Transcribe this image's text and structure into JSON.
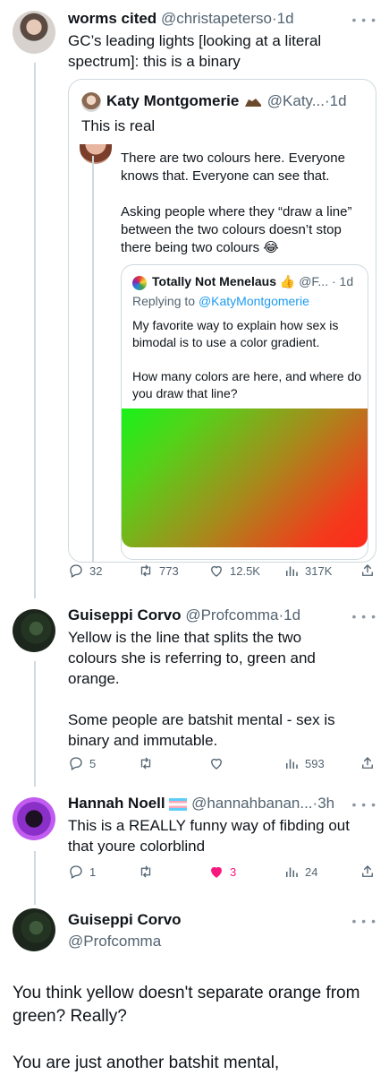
{
  "tweet1": {
    "name": "worms cited",
    "handle": "@christapeterso",
    "time": "1d",
    "text": "GC’s leading lights [looking at a literal spectrum]: this is a binary",
    "quote": {
      "name": "Katy Montgomerie",
      "handle": "@Katy...",
      "time": "1d",
      "text": "This is real",
      "inner_text": "There are two colours here. Everyone knows that. Everyone can see that.\n\nAsking people where they “draw a line” between the two colours doesn’t stop there being two colours 😂",
      "nested": {
        "name": "Totally Not Menelaus",
        "handle": "@F...",
        "time": "1d",
        "reply_prefix": "Replying to ",
        "reply_to": "@KatyMontgomerie",
        "text": "My favorite way to explain how sex is bimodal is to use a color gradient.\n\nHow many colors are here, and where do you draw that line?",
        "gradient_colors": [
          "#18f21a",
          "#f33a1c"
        ]
      }
    },
    "stats": {
      "replies": "32",
      "retweets": "773",
      "likes": "12.5K",
      "views": "317K"
    }
  },
  "tweet2": {
    "name": "Guiseppi Corvo",
    "handle": "@Profcomma",
    "time": "1d",
    "text": "Yellow is the line that splits the two colours she is referring to, green and orange.\n\nSome people are batshit mental - sex is binary and immutable.",
    "stats": {
      "replies": "5",
      "retweets": "",
      "likes": "",
      "views": "593"
    }
  },
  "tweet3": {
    "name": "Hannah Noell",
    "handle": "@hannahbanan...",
    "time": "3h",
    "text": "This is a REALLY funny way of fibding out that youre colorblind",
    "stats": {
      "replies": "1",
      "retweets": "",
      "likes": "3",
      "views": "24"
    }
  },
  "tweet4": {
    "name": "Guiseppi Corvo",
    "handle": "@Profcomma",
    "text": "You think yellow doesn't separate orange from green? Really?\n\nYou are just another batshit mental,"
  },
  "colors": {
    "text": "#0f1419",
    "secondary": "#536471",
    "accent": "#1d9bf0",
    "like": "#f91880",
    "border": "#cfd9de"
  },
  "icons": [
    "reply-icon",
    "retweet-icon",
    "like-icon",
    "views-icon",
    "share-icon",
    "more-icon"
  ]
}
